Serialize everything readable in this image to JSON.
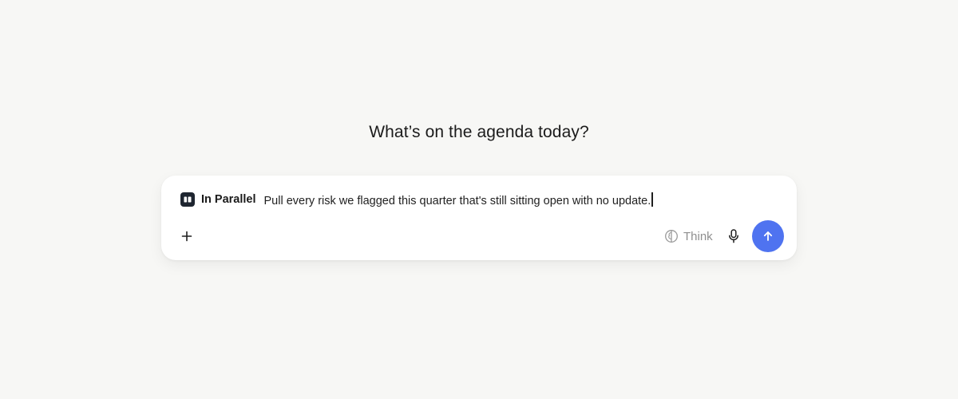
{
  "heading": "What’s on the agenda today?",
  "composer": {
    "chip": {
      "icon": "board-icon",
      "label": "In Parallel"
    },
    "input_value": "Pull every risk we flagged this quarter that's still sitting open with no update.",
    "add_icon": "plus-icon",
    "think": {
      "icon": "brain-icon",
      "label": "Think"
    },
    "mic_icon": "microphone-icon",
    "send_icon": "arrow-up-icon",
    "send_color": "#4f73f0"
  }
}
